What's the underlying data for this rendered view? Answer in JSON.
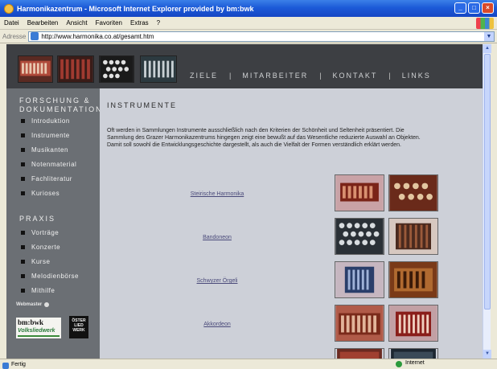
{
  "window": {
    "title": "Harmonikazentrum - Microsoft Internet Explorer provided by bm:bwk",
    "menu": [
      "Datei",
      "Bearbeiten",
      "Ansicht",
      "Favoriten",
      "Extras",
      "?"
    ],
    "address_label": "Adresse",
    "address_url": "http://www.harmonika.co.at/gesamt.htm",
    "status_left": "Fertig",
    "status_right": "Internet"
  },
  "nav": {
    "items": [
      "ZIELE",
      "MITARBEITER",
      "KONTAKT",
      "LINKS"
    ],
    "separator": "|"
  },
  "sidebar": {
    "section1": "FORSCHUNG & DOKUMENTATION",
    "section1_items": [
      "Introduktion",
      "Instrumente",
      "Musikanten",
      "Notenmaterial",
      "Fachliteratur",
      "Kurioses"
    ],
    "section2": "PRAXIS",
    "section2_items": [
      "Vorträge",
      "Konzerte",
      "Kurse",
      "Melodienbörse",
      "Mithilfe"
    ],
    "webmaster": "Webmaster",
    "logo1_line1": "bm:bwk",
    "logo1_line2": "Volksliedwerk",
    "logo2_text": "ÖSTER LIED WERK"
  },
  "content": {
    "title": "INSTRUMENTE",
    "intro": "Oft werden in Sammlungen Instrumente ausschließlich nach den Kriterien der Schönheit und Seltenheit präsentiert. Die Sammlung des Grazer Harmonikazentrums hingegen zeigt eine bewußt auf das Wesentliche reduzierte Auswahl an Objekten. Damit soll sowohl die Entwicklungsgeschichte dargestellt, als auch die Vielfalt der Formen verständlich erklärt werden.",
    "instruments": [
      "Steirische Harmonika",
      "Bandoneon",
      "Schwyzer Örgeli",
      "Akkordeon"
    ]
  },
  "colors": {
    "header_bg": "#3d3f43",
    "sidebar_bg": "#6b6f74",
    "content_bg": "#cdd0d8",
    "link": "#4a4a7a",
    "titlebar": "#1c5ad8"
  }
}
